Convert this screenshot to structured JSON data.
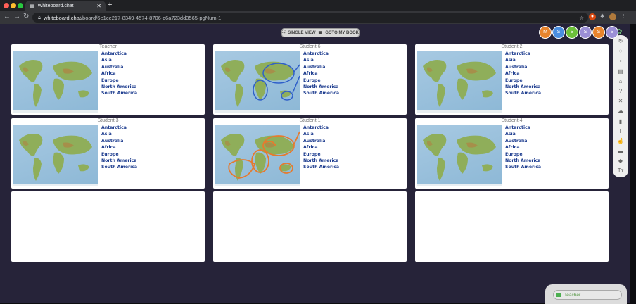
{
  "browser": {
    "tab_title": "Whiteboard.chat",
    "url_host": "whiteboard.chat",
    "url_path": "/board/6e1ce217-8349-4574-8706-c6a723dd3565-pgNum-1"
  },
  "header": {
    "single_view": "SINGLE VIEW",
    "goto_book": "GOTO MY BOOK"
  },
  "avatars": [
    {
      "initial": "M",
      "color": "#e8842c"
    },
    {
      "initial": "S",
      "color": "#4a8ee0"
    },
    {
      "initial": "S",
      "color": "#6cbf3a"
    },
    {
      "initial": "S",
      "color": "#9b8fd6"
    },
    {
      "initial": "S",
      "color": "#e8842c"
    },
    {
      "initial": "S",
      "color": "#9b8fd6"
    }
  ],
  "continents": [
    "Antarctica",
    "Asia",
    "Australia",
    "Africa",
    "Europe",
    "North America",
    "South America"
  ],
  "boards": [
    {
      "label": "Teacher",
      "annotation": "none"
    },
    {
      "label": "Student 6",
      "annotation": "blue"
    },
    {
      "label": "Student 2",
      "annotation": "none"
    },
    {
      "label": "Student 3",
      "annotation": "none"
    },
    {
      "label": "Student 1",
      "annotation": "orange"
    },
    {
      "label": "Student 4",
      "annotation": "none"
    },
    {
      "label": "",
      "annotation": "empty"
    },
    {
      "label": "",
      "annotation": "empty"
    },
    {
      "label": "",
      "annotation": "empty"
    }
  ],
  "toolbar_icons": [
    "redo-icon",
    "hide-icon",
    "save-icon",
    "gallery-icon",
    "home-icon",
    "help-icon",
    "close-icon",
    "upload-cloud-icon",
    "delete-icon",
    "pause-icon",
    "pointer-icon",
    "shapes-icon",
    "eraser-icon",
    "text-icon"
  ],
  "footer": {
    "teacher_button": "Teacher"
  }
}
